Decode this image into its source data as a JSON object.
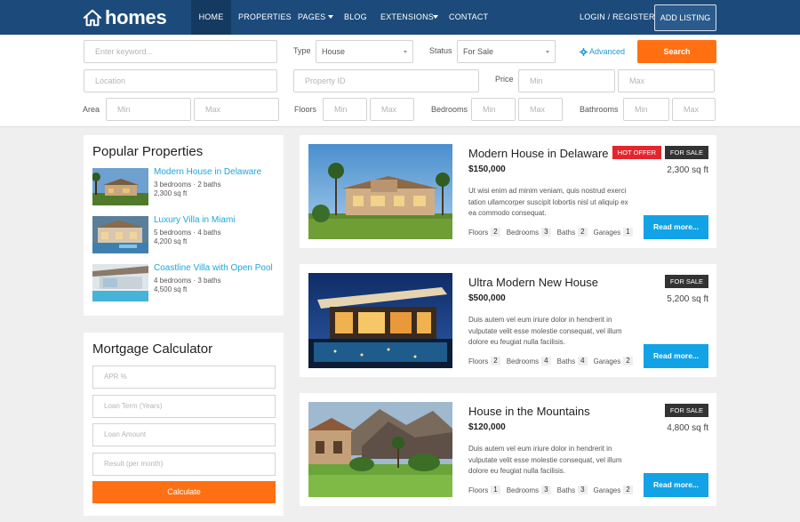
{
  "brand": {
    "name": "homes"
  },
  "nav": {
    "items": [
      {
        "label": "HOME"
      },
      {
        "label": "PROPERTIES"
      },
      {
        "label": "PAGES"
      },
      {
        "label": "BLOG"
      },
      {
        "label": "EXTENSIONS"
      },
      {
        "label": "CONTACT"
      }
    ],
    "login": "LOGIN / REGISTER",
    "add_listing": "ADD LISTING"
  },
  "search": {
    "keyword_placeholder": "Enter keyword...",
    "type_label": "Type",
    "type_value": "House",
    "status_label": "Status",
    "status_value": "For Sale",
    "advanced": "Advanced",
    "search_button": "Search",
    "location_placeholder": "Location",
    "property_id_placeholder": "Property ID",
    "price_label": "Price",
    "price_min": "Min",
    "price_max": "Max",
    "area_label": "Area",
    "area_min": "Min",
    "area_max": "Max",
    "floors_label": "Floors",
    "floors_min": "Min",
    "floors_max": "Max",
    "bedrooms_label": "Bedrooms",
    "bedrooms_min": "Min",
    "bedrooms_max": "Max",
    "bathrooms_label": "Bathrooms",
    "bathrooms_min": "Min",
    "bathrooms_max": "Max"
  },
  "popular": {
    "title": "Popular Properties",
    "items": [
      {
        "name": "Modern House in Delaware",
        "rooms": "3 bedrooms · 2 baths",
        "area": "2,300 sq ft"
      },
      {
        "name": "Luxury Villa in Miami",
        "rooms": "5 bedrooms · 4 baths",
        "area": "4,200 sq ft"
      },
      {
        "name": "Coastline Villa with Open Pool",
        "rooms": "4 bedrooms · 3 baths",
        "area": "4,500 sq ft"
      }
    ]
  },
  "mortgage": {
    "title": "Mortgage Calculator",
    "apr_placeholder": "APR %",
    "term_placeholder": "Loan Term (Years)",
    "amount_placeholder": "Loan Amount",
    "result_placeholder": "Result (per month)",
    "calculate": "Calculate"
  },
  "listings": [
    {
      "title": "Modern House in Delaware",
      "price": "$150,000",
      "area": "2,300 sq ft",
      "hot_badge": "HOT OFFER",
      "sale_badge": "FOR SALE",
      "description": "Ut wisi enim ad minim veniam, quis nostrud exerci tation ullamcorper suscipit lobortis nisl ut aliquip ex ea commodo consequat.",
      "floors_label": "Floors",
      "floors": "2",
      "bedrooms_label": "Bedrooms",
      "bedrooms": "3",
      "baths_label": "Baths",
      "baths": "2",
      "garages_label": "Garages",
      "garages": "1",
      "more": "Read more..."
    },
    {
      "title": "Ultra Modern New House",
      "price": "$500,000",
      "area": "5,200 sq ft",
      "sale_badge": "FOR SALE",
      "description": "Duis autem vel eum iriure dolor in hendrerit in vulputate velit esse molestie consequat, vel illum dolore eu feugiat nulla facilisis.",
      "floors_label": "Floors",
      "floors": "2",
      "bedrooms_label": "Bedrooms",
      "bedrooms": "4",
      "baths_label": "Baths",
      "baths": "4",
      "garages_label": "Garages",
      "garages": "2",
      "more": "Read more..."
    },
    {
      "title": "House in the Mountains",
      "price": "$120,000",
      "area": "4,800 sq ft",
      "sale_badge": "FOR SALE",
      "description": "Duis autem vel eum iriure dolor in hendrerit in vulputate velit esse molestie consequat, vel illum dolore eu feugiat nulla facilisis.",
      "floors_label": "Floors",
      "floors": "1",
      "bedrooms_label": "Bedrooms",
      "bedrooms": "3",
      "baths_label": "Baths",
      "baths": "3",
      "garages_label": "Garages",
      "garages": "2",
      "more": "Read more..."
    }
  ],
  "colors": {
    "nav_bg": "#1c4b7b",
    "accent_orange": "#ff7012",
    "accent_blue": "#12a2e6",
    "link_blue": "#1ea5dd",
    "hot_red": "#e3262d",
    "badge_dark": "#333333"
  },
  "icons": {
    "logo": "house-icon",
    "advanced": "gear-icon"
  }
}
